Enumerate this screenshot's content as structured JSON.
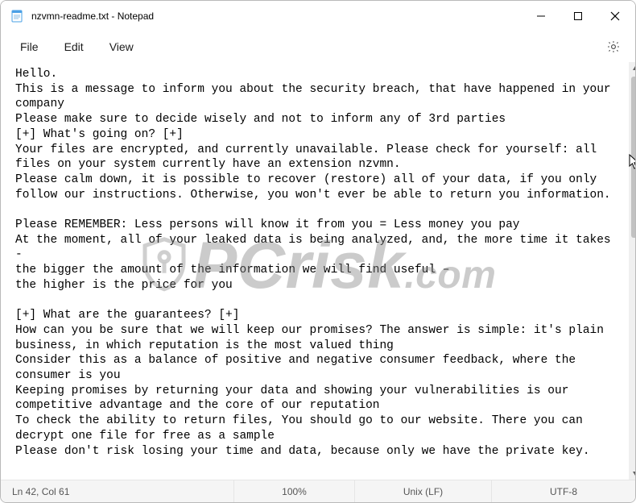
{
  "titlebar": {
    "filename": "nzvmn-readme.txt",
    "separator": " - ",
    "appname": "Notepad"
  },
  "menubar": {
    "file": "File",
    "edit": "Edit",
    "view": "View"
  },
  "editor": {
    "text": "Hello.\nThis is a message to inform you about the security breach, that have happened in your company\nPlease make sure to decide wisely and not to inform any of 3rd parties\n[+] What's going on? [+]\nYour files are encrypted, and currently unavailable. Please check for yourself: all files on your system currently have an extension nzvmn.\nPlease calm down, it is possible to recover (restore) all of your data, if you only follow our instructions. Otherwise, you won't ever be able to return you information.\n\nPlease REMEMBER: Less persons will know it from you = Less money you pay\nAt the moment, all of your leaked data is being analyzed, and, the more time it takes -\nthe bigger the amount of the information we will find useful –\nthe higher is the price for you\n\n[+] What are the guarantees? [+]\nHow can you be sure that we will keep our promises? The answer is simple: it's plain business, in which reputation is the most valued thing\nConsider this as a balance of positive and negative consumer feedback, where the consumer is you\nKeeping promises by returning your data and showing your vulnerabilities is our competitive advantage and the core of our reputation\nTo check the ability to return files, You should go to our website. There you can decrypt one file for free as a sample\nPlease don't risk losing your time and data, because only we have the private key.\n"
  },
  "statusbar": {
    "position": "Ln 42, Col 61",
    "zoom": "100%",
    "eol": "Unix (LF)",
    "encoding": "UTF-8"
  },
  "icons": {
    "app": "notepad-icon",
    "minimize": "minimize-icon",
    "maximize": "maximize-icon",
    "close": "close-icon",
    "settings": "gear-icon",
    "scroll_up": "chevron-up-icon",
    "scroll_down": "chevron-down-icon"
  },
  "watermark": {
    "text": "PCrisk",
    "suffix": ".com"
  }
}
